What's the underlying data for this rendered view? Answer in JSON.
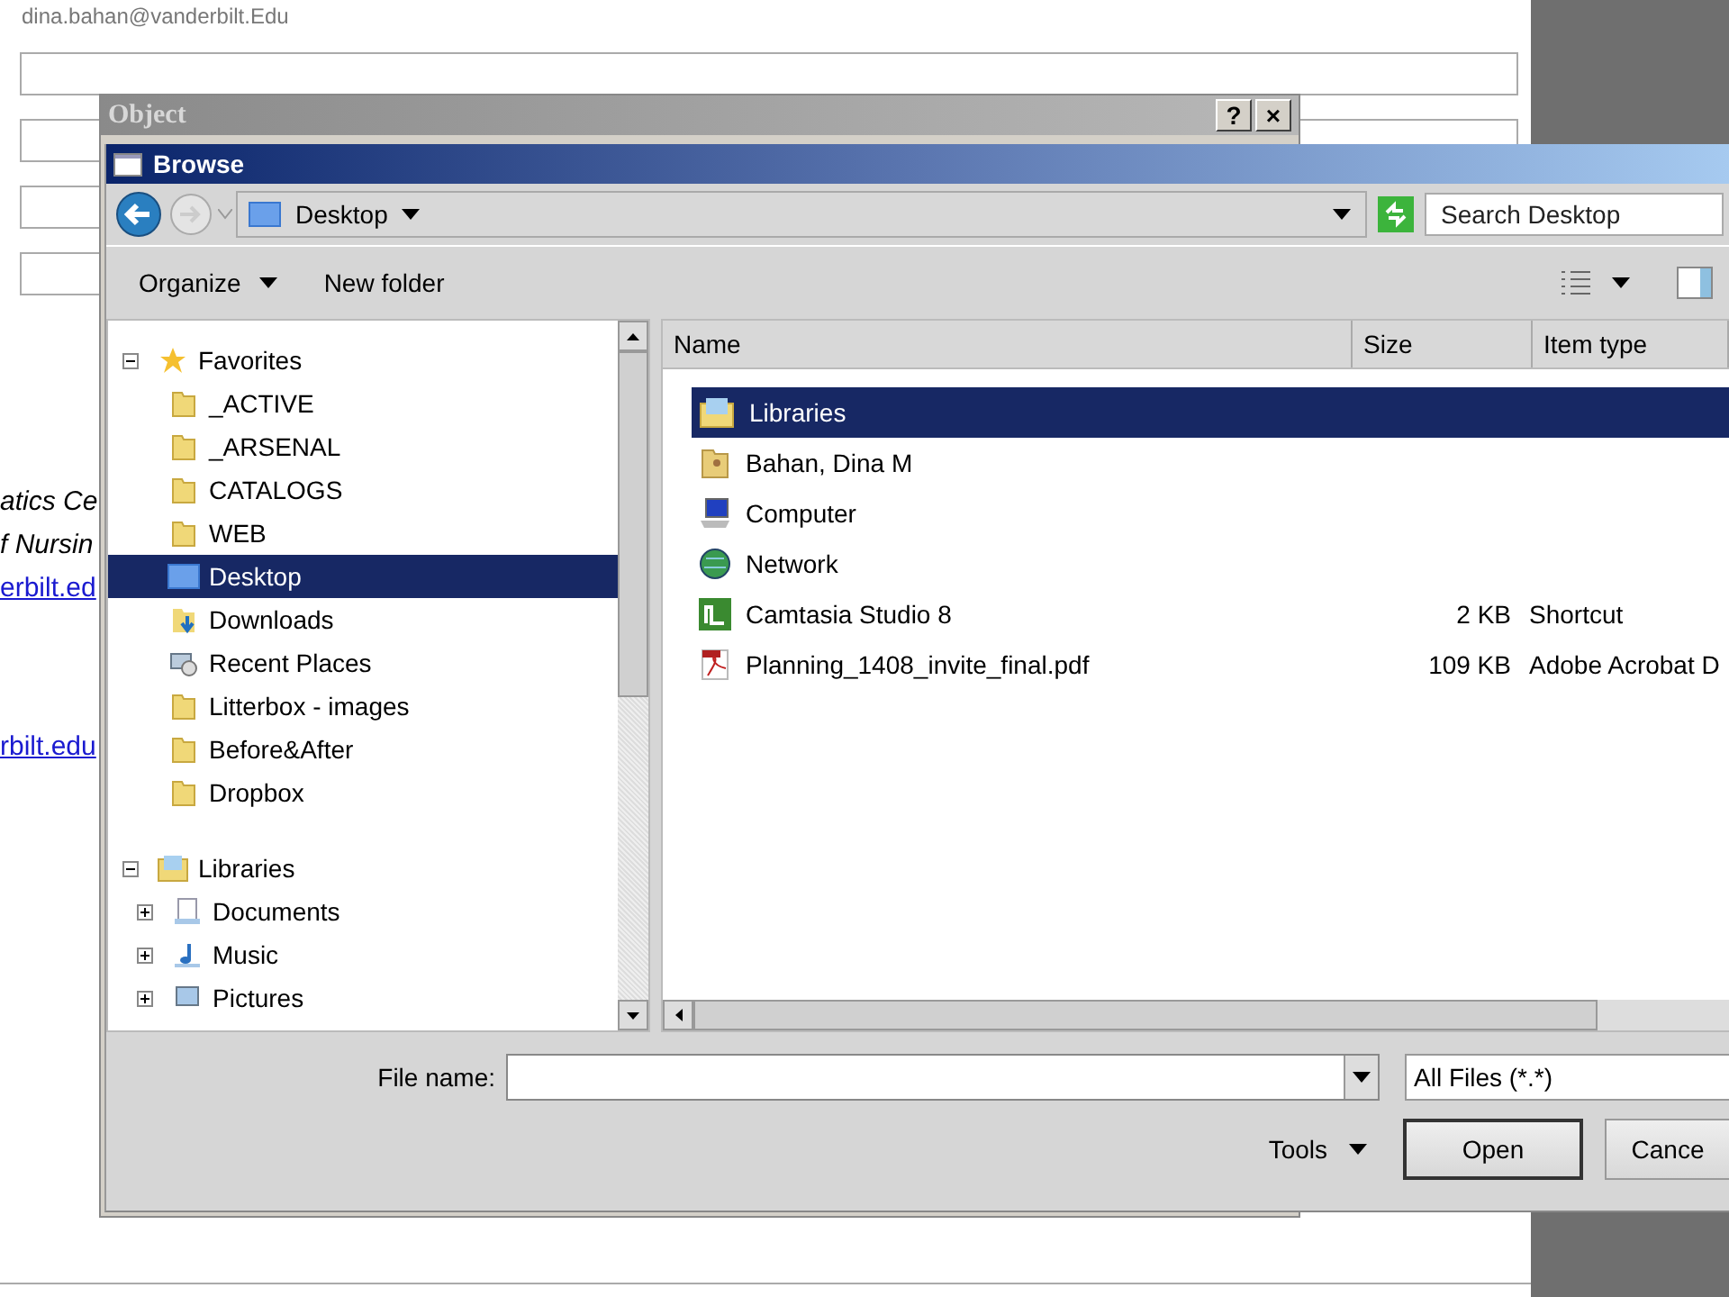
{
  "document": {
    "email": "dina.bahan@vanderbilt.Edu",
    "left_texts": [
      {
        "text": "atics Ce",
        "kind": "italic"
      },
      {
        "text": "f Nursin",
        "kind": "italic"
      },
      {
        "text": "erbilt.ed",
        "kind": "link"
      },
      {
        "text": "rbilt.edu",
        "kind": "link"
      }
    ]
  },
  "object_dialog": {
    "title": "Object",
    "help": "?",
    "close": "×"
  },
  "browse_dialog": {
    "title": "Browse",
    "location": "Desktop",
    "search": {
      "placeholder": "Search Desktop"
    },
    "toolbar": [
      "Organize",
      "New folder"
    ],
    "tree": [
      {
        "label": "Favorites",
        "kind": "star",
        "expanded": true,
        "selected": false,
        "children": [
          {
            "label": "_ACTIVE",
            "kind": "folder",
            "selected": false
          },
          {
            "label": "_ARSENAL",
            "kind": "folder",
            "selected": false
          },
          {
            "label": "CATALOGS",
            "kind": "folder",
            "selected": false
          },
          {
            "label": "WEB",
            "kind": "folder",
            "selected": false
          },
          {
            "label": "Desktop",
            "kind": "desktop",
            "selected": true
          },
          {
            "label": "Downloads",
            "kind": "downloads",
            "selected": false
          },
          {
            "label": "Recent Places",
            "kind": "recent",
            "selected": false
          },
          {
            "label": "Litterbox - images",
            "kind": "folder",
            "selected": false
          },
          {
            "label": "Before&After",
            "kind": "folder",
            "selected": false
          },
          {
            "label": "Dropbox",
            "kind": "folder",
            "selected": false
          }
        ]
      },
      {
        "label": "Libraries",
        "kind": "library",
        "expanded": true,
        "selected": false,
        "children": [
          {
            "label": "Documents",
            "kind": "documents",
            "expanded": false,
            "selected": false
          },
          {
            "label": "Music",
            "kind": "music",
            "expanded": false,
            "selected": false
          },
          {
            "label": "Pictures",
            "kind": "pictures",
            "expanded": false,
            "selected": false
          }
        ]
      }
    ],
    "columns": [
      "Name",
      "Size",
      "Item type"
    ],
    "files": [
      {
        "name": "Libraries",
        "kind": "library",
        "selected": true
      },
      {
        "name": "Bahan, Dina M",
        "kind": "user-folder",
        "selected": false
      },
      {
        "name": "Computer",
        "kind": "computer",
        "selected": false
      },
      {
        "name": "Network",
        "kind": "network",
        "selected": false
      },
      {
        "name": "Camtasia Studio 8",
        "kind": "app",
        "size": "2 KB",
        "type": "Shortcut",
        "selected": false
      },
      {
        "name": "Planning_1408_invite_final.pdf",
        "kind": "pdf",
        "size": "109 KB",
        "type": "Adobe Acrobat D",
        "selected": false
      }
    ],
    "file_name_label": "File name:",
    "filter": "All Files (*.*)",
    "tools": "Tools",
    "buttons": [
      "Open",
      "Cance"
    ]
  }
}
